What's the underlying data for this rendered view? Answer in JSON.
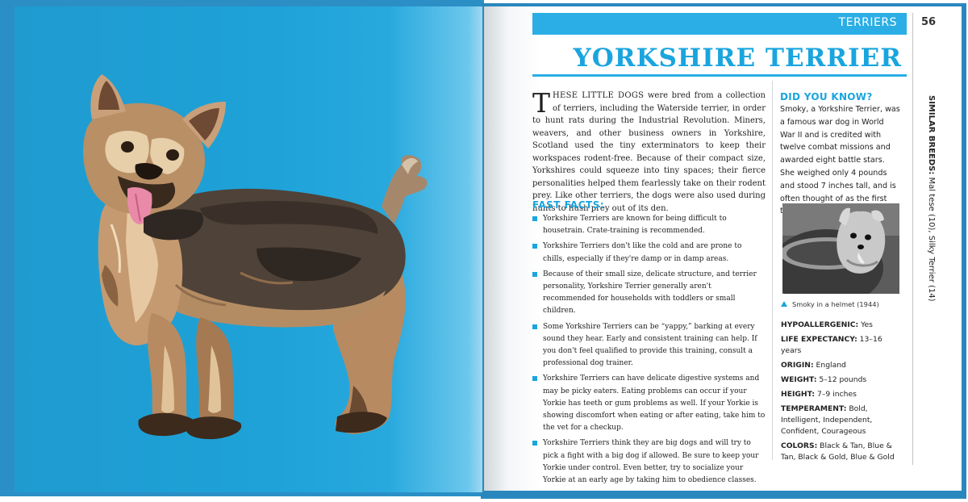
{
  "header": {
    "section": "TERRIERS",
    "page_number": "56",
    "title": "YORKSHIRE TERRIER"
  },
  "intro": {
    "dropcap": "T",
    "lead": "HESE LITTLE DOGS",
    "text": " were bred from a collection of terriers, including the Waterside terrier, in order to hunt rats during the Industrial Revolution. Miners, weavers, and other business owners in Yorkshire, Scotland used the tiny exterminators to keep their workspaces rodent-free. Because of their compact size, Yorkshires could squeeze into tiny spaces; their fierce personalities helped them fearlessly take on their rodent prey. Like other terriers, the dogs were also used during hunts to flush prey out of its den."
  },
  "fast_facts": {
    "heading": "FAST FACTS:",
    "items": [
      "Yorkshire Terriers are known for being difficult to housetrain. Crate-training is recommended.",
      "Yorkshire Terriers don't like the cold and are prone to chills, especially if they're damp or in damp areas.",
      "Because of their small size, delicate structure, and terrier personality, Yorkshire Terrier generally aren't recommended for households with toddlers or small children.",
      "Some Yorkshire Terriers can be “yappy,” barking at every sound they hear. Early and consistent training can help. If you don't feel qualified to provide this training, consult a professional dog trainer.",
      "Yorkshire Terriers can have delicate digestive systems and may be picky eaters. Eating problems can occur if your Yorkie has teeth or gum problems as well. If your Yorkie is showing discomfort when eating or after eating, take him to the vet for a checkup.",
      "Yorkshire Terriers think they are big dogs and will try to pick a fight with a big dog if allowed. Be sure to keep your Yorkie under control. Even better, try to socialize your Yorkie at an early age by taking him to obedience classes."
    ]
  },
  "did_you_know": {
    "heading": "DID YOU KNOW?",
    "text": "Smoky, a Yorkshire Terrier, was a famous war dog in World War II and is credited with twelve combat missions and awarded eight battle stars. She weighed only 4 pounds and stood 7 inches tall, and is often thought of as the first therapy dog."
  },
  "photo": {
    "caption": "Smoky in a helmet (1944)"
  },
  "stats": {
    "hypo_label": "HYPOALLERGENIC:",
    "hypo_value": " Yes",
    "life_label": "LIFE EXPECTANCY:",
    "life_value": " 13–16 years",
    "origin_label": "ORIGIN:",
    "origin_value": " England",
    "weight_label": "WEIGHT:",
    "weight_value": " 5–12 pounds",
    "height_label": "HEIGHT:",
    "height_value": " 7–9 inches",
    "temperament_label": "TEMPERAMENT:",
    "temperament_value": "  Bold, Intelligent, Independent, Confident, Courageous",
    "colors_label": "COLORS:",
    "colors_value": " Black & Tan, Blue & Tan, Black & Gold, Blue & Gold"
  },
  "similar_breeds": {
    "label": "SIMILAR BREEDS:",
    "value": " Mal tese (10), Silky Terrier (14)"
  },
  "colors": {
    "accent": "#1aa5de",
    "left_page": "#1f9bd0",
    "illustration_bg": "#1ea2d8"
  }
}
